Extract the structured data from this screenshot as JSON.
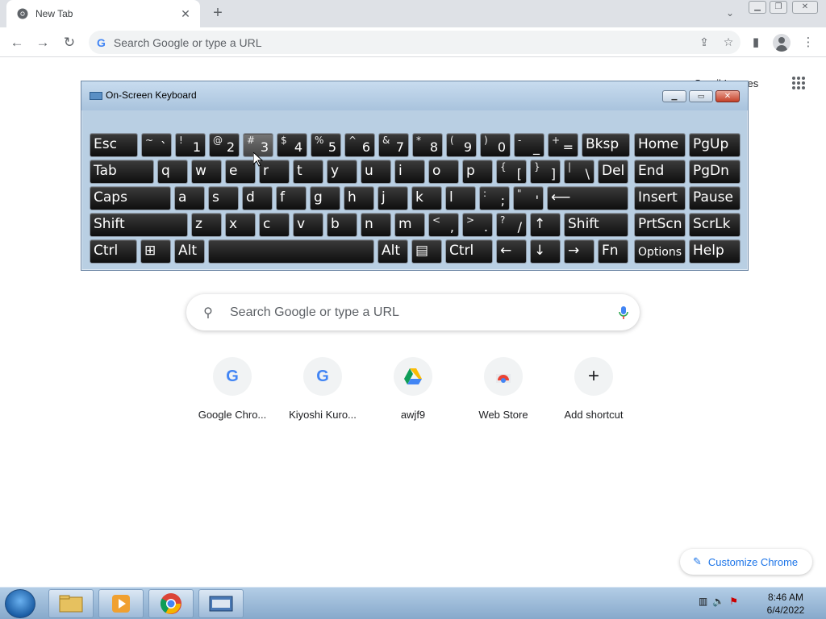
{
  "browser": {
    "tab_title": "New Tab",
    "tab_close": "✕",
    "new_tab": "+",
    "omnibox_placeholder": "Search Google or type a URL"
  },
  "ntp": {
    "top_link": "Gmail Images",
    "search_placeholder": "Search Google or type a URL",
    "customize": "Customize Chrome",
    "shortcuts": [
      {
        "label": "Google Chro...",
        "icon": "google-icon"
      },
      {
        "label": "Kiyoshi Kuro...",
        "icon": "google-icon"
      },
      {
        "label": "awjf9",
        "icon": "google-drive-icon"
      },
      {
        "label": "Web Store",
        "icon": "chrome-web-store-icon"
      },
      {
        "label": "Add shortcut",
        "icon": "plus-icon"
      }
    ]
  },
  "osk": {
    "title": "On-Screen Keyboard",
    "rows": [
      [
        {
          "l": "Esc"
        },
        {
          "t": "~",
          "b": "`"
        },
        {
          "t": "!",
          "b": "1"
        },
        {
          "t": "@",
          "b": "2"
        },
        {
          "t": "#",
          "b": "3",
          "active": true
        },
        {
          "t": "$",
          "b": "4"
        },
        {
          "t": "%",
          "b": "5"
        },
        {
          "t": "^",
          "b": "6"
        },
        {
          "t": "&",
          "b": "7"
        },
        {
          "t": "*",
          "b": "8"
        },
        {
          "t": "(",
          "b": "9"
        },
        {
          "t": ")",
          "b": "0"
        },
        {
          "t": "-",
          "b": "_"
        },
        {
          "t": "+",
          "b": "="
        },
        {
          "l": "Bksp"
        },
        {
          "l": "Home"
        },
        {
          "l": "PgUp"
        }
      ],
      [
        {
          "l": "Tab"
        },
        {
          "l": "q"
        },
        {
          "l": "w"
        },
        {
          "l": "e"
        },
        {
          "l": "r"
        },
        {
          "l": "t"
        },
        {
          "l": "y"
        },
        {
          "l": "u"
        },
        {
          "l": "i"
        },
        {
          "l": "o"
        },
        {
          "l": "p"
        },
        {
          "t": "{",
          "b": "["
        },
        {
          "t": "}",
          "b": "]"
        },
        {
          "t": "|",
          "b": "\\"
        },
        {
          "l": "Del"
        },
        {
          "l": "End"
        },
        {
          "l": "PgDn"
        }
      ],
      [
        {
          "l": "Caps"
        },
        {
          "l": "a"
        },
        {
          "l": "s"
        },
        {
          "l": "d"
        },
        {
          "l": "f"
        },
        {
          "l": "g"
        },
        {
          "l": "h"
        },
        {
          "l": "j"
        },
        {
          "l": "k"
        },
        {
          "l": "l"
        },
        {
          "t": ":",
          "b": ";"
        },
        {
          "t": "\"",
          "b": "'"
        },
        {
          "l": "⟵"
        },
        {
          "l": "Insert"
        },
        {
          "l": "Pause"
        }
      ],
      [
        {
          "l": "Shift"
        },
        {
          "l": "z"
        },
        {
          "l": "x"
        },
        {
          "l": "c"
        },
        {
          "l": "v"
        },
        {
          "l": "b"
        },
        {
          "l": "n"
        },
        {
          "l": "m"
        },
        {
          "t": "<",
          "b": ","
        },
        {
          "t": ">",
          "b": "."
        },
        {
          "t": "?",
          "b": "/"
        },
        {
          "l": "↑"
        },
        {
          "l": "Shift"
        },
        {
          "l": "PrtScn"
        },
        {
          "l": "ScrLk"
        }
      ],
      [
        {
          "l": "Ctrl"
        },
        {
          "l": "⊞"
        },
        {
          "l": "Alt"
        },
        {
          "l": ""
        },
        {
          "l": "Alt"
        },
        {
          "l": "▤"
        },
        {
          "l": "Ctrl"
        },
        {
          "l": "←"
        },
        {
          "l": "↓"
        },
        {
          "l": "→"
        },
        {
          "l": "Fn"
        },
        {
          "l": "Options",
          "small": true
        },
        {
          "l": "Help"
        }
      ]
    ]
  },
  "taskbar": {
    "time": "8:46 AM",
    "date": "6/4/2022"
  }
}
